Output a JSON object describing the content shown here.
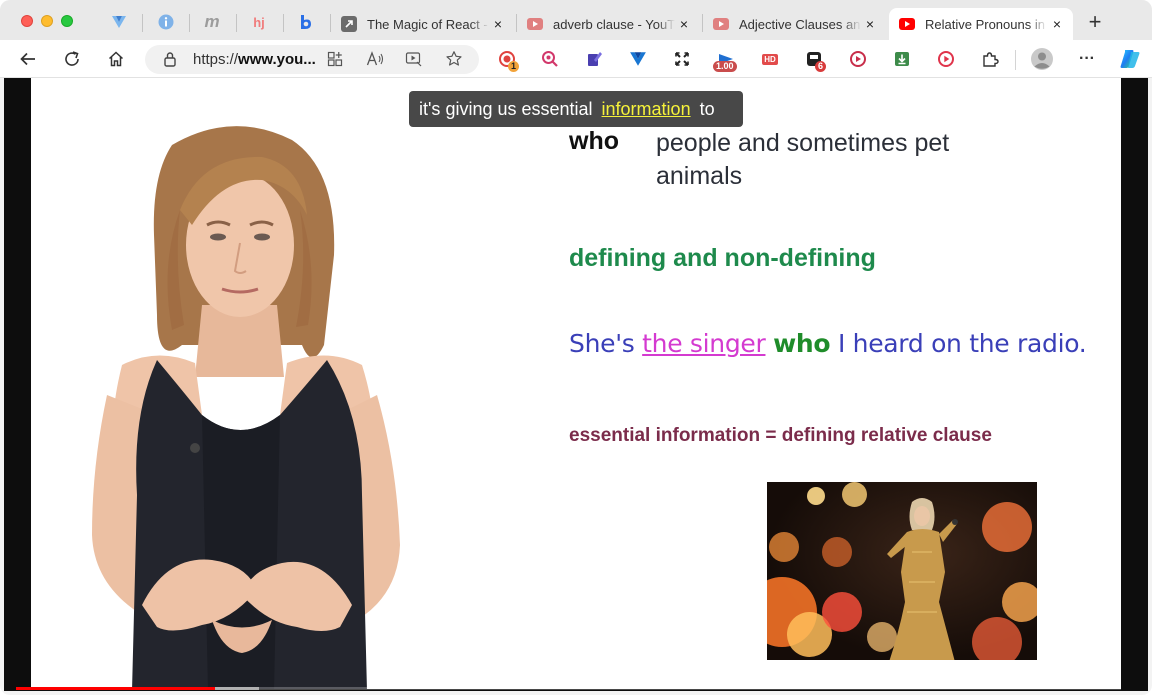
{
  "browser": {
    "pinned_tabs": [
      {
        "icon": "vuetify-icon"
      },
      {
        "icon": "info-circle-icon"
      },
      {
        "icon": "m-logo-icon",
        "text": "m"
      },
      {
        "icon": "hotjar-icon",
        "text": "hj"
      },
      {
        "icon": "b-logo-icon",
        "text": "b"
      }
    ],
    "tabs": [
      {
        "title": "The Magic of React -",
        "icon": "arrow-link-icon",
        "active": false
      },
      {
        "title": "adverb clause - YouTube",
        "icon": "youtube-icon",
        "active": false
      },
      {
        "title": "Adjective Clauses and",
        "icon": "youtube-icon",
        "active": false
      },
      {
        "title": "Relative Pronouns in English",
        "icon": "youtube-icon",
        "active": true
      }
    ],
    "new_tab_label": "+",
    "close_label": "×",
    "address": {
      "scheme": "https://",
      "host": "www.you...",
      "full_hint": "https://www.youtube.com"
    },
    "extension_badges": {
      "first": "1",
      "speed": "1.00",
      "counter": "6",
      "hd": "HD"
    },
    "menu_label": "···"
  },
  "video": {
    "caption": {
      "before": "it's giving us essential",
      "highlight": "information",
      "after": "to"
    },
    "slide": {
      "who_word": "who",
      "who_description": "people and sometimes pet animals",
      "defining_heading": "defining and non-defining",
      "example": {
        "part1": "She's ",
        "highlight": "the singer",
        "part2": " ",
        "who": "who",
        "part3": " I heard on the radio."
      },
      "essential_line": "essential information = defining relative clause"
    },
    "progress": {
      "played_fraction": 0.18,
      "buffered_fraction": 0.22
    }
  },
  "colors": {
    "accent_red": "#ff0000",
    "defining_green": "#1e8a4c",
    "example_blue": "#3a3fb8",
    "singer_pink": "#d43ad0",
    "essential_maroon": "#7b2c4b",
    "caption_highlight": "#f6f23a"
  }
}
